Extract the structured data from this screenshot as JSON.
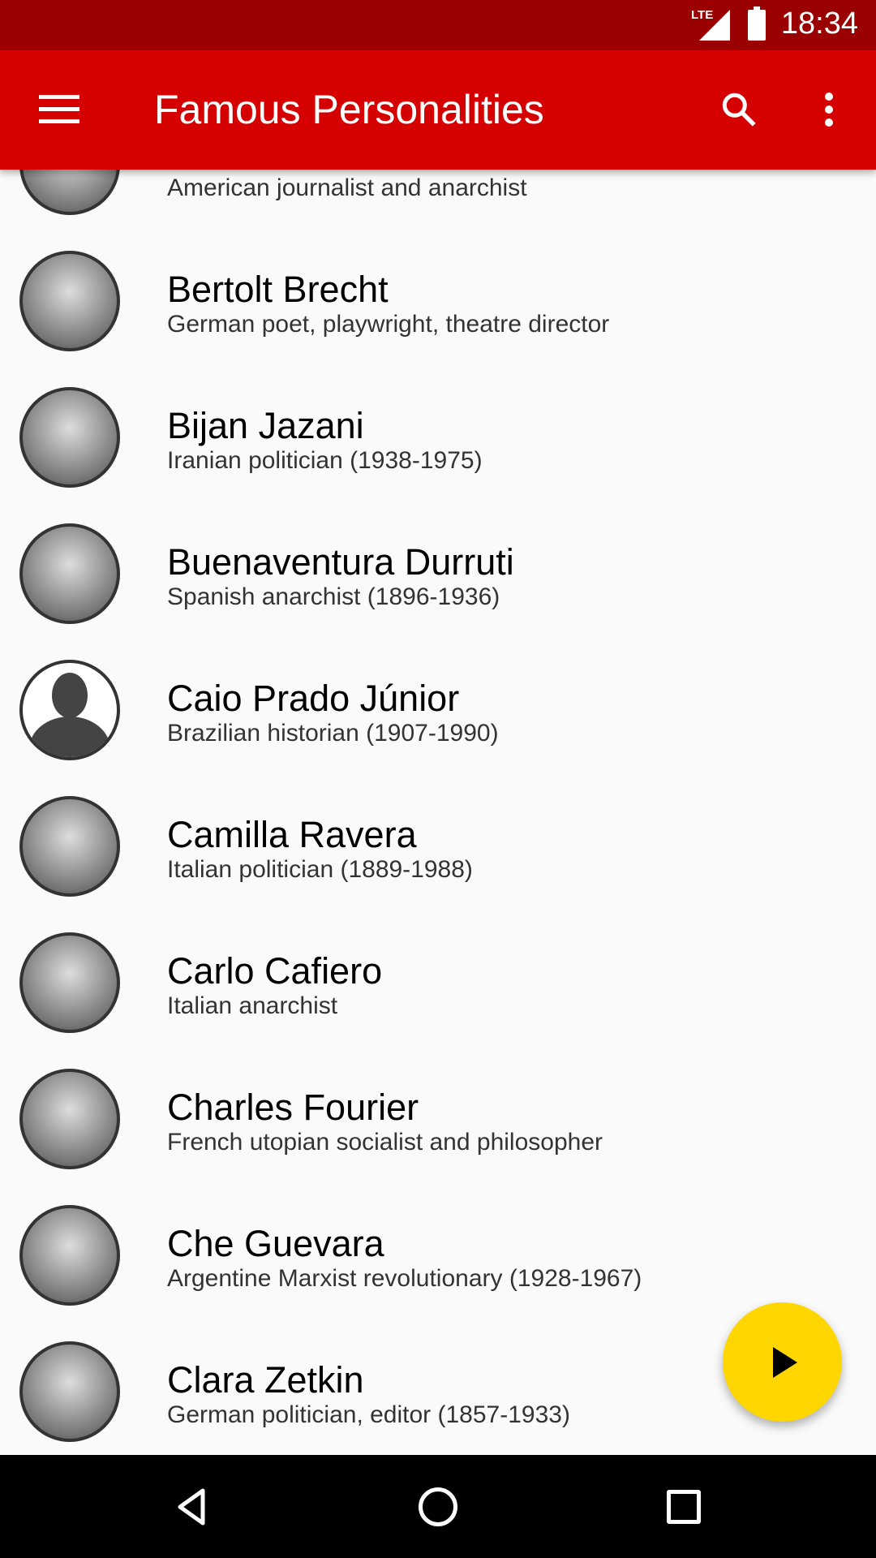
{
  "status_bar": {
    "time": "18:34",
    "network": "LTE"
  },
  "toolbar": {
    "title": "Famous Personalities",
    "menu_icon": "hamburger-menu-icon",
    "search_icon": "search-icon",
    "more_icon": "more-vert-icon"
  },
  "colors": {
    "status_bar": "#9b0000",
    "toolbar": "#d50000",
    "fab": "#ffd600"
  },
  "people": [
    {
      "name": "",
      "description": "American journalist and anarchist"
    },
    {
      "name": "Bertolt Brecht",
      "description": "German poet, playwright, theatre director"
    },
    {
      "name": "Bijan Jazani",
      "description": "Iranian politician (1938-1975)"
    },
    {
      "name": "Buenaventura Durruti",
      "description": "Spanish anarchist (1896-1936)"
    },
    {
      "name": "Caio Prado Júnior",
      "description": "Brazilian historian (1907-1990)"
    },
    {
      "name": "Camilla Ravera",
      "description": "Italian politician (1889-1988)"
    },
    {
      "name": "Carlo Cafiero",
      "description": "Italian anarchist"
    },
    {
      "name": "Charles Fourier",
      "description": "French utopian socialist and philosopher"
    },
    {
      "name": "Che Guevara",
      "description": "Argentine Marxist revolutionary (1928-1967)"
    },
    {
      "name": "Clara Zetkin",
      "description": "German politician, editor (1857-1933)"
    }
  ],
  "fab": {
    "icon": "play-icon"
  },
  "nav_bar": {
    "back": "back-icon",
    "home": "home-icon",
    "recents": "recents-icon"
  }
}
